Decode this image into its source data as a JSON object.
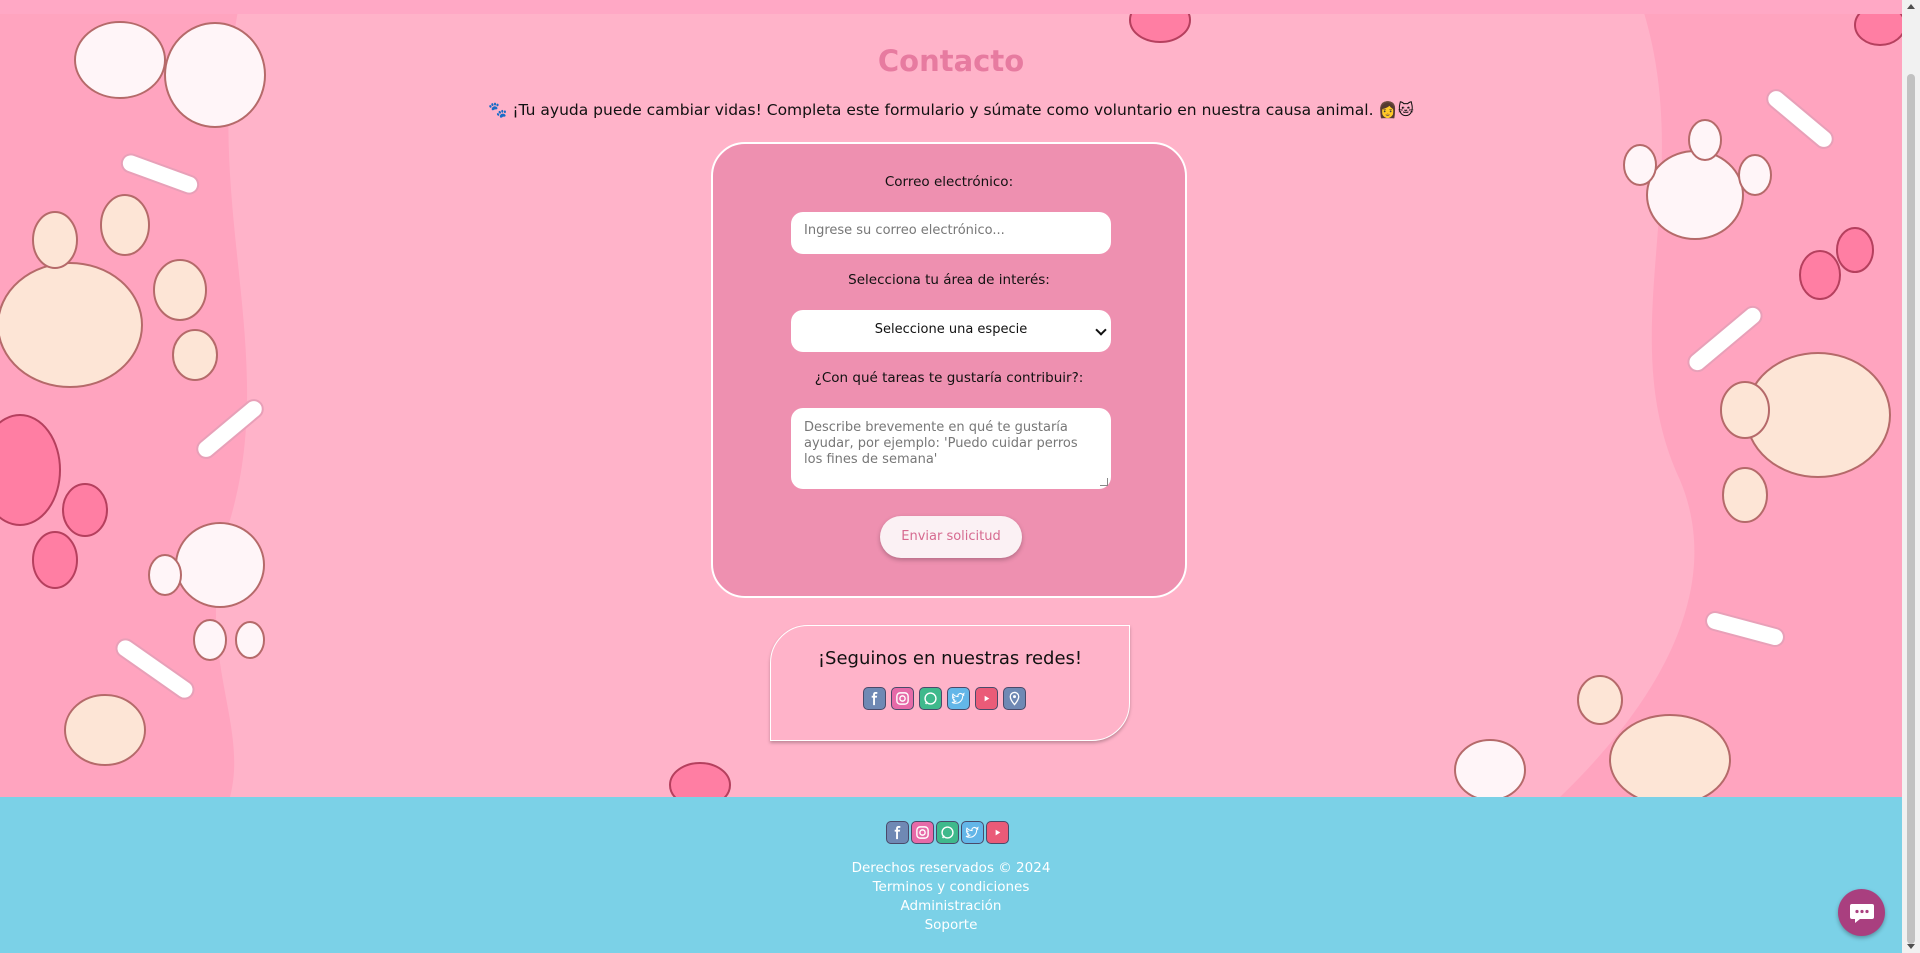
{
  "page": {
    "title": "Contacto",
    "intro": "🐾 ¡Tu ayuda puede cambiar vidas! Completa este formulario y súmate como voluntario en nuestra causa animal. 👩🐱"
  },
  "form": {
    "email_label": "Correo electrónico:",
    "email_placeholder": "Ingrese su correo electrónico...",
    "interest_label": "Selecciona tu área de interés:",
    "interest_selected": "Seleccione una especie",
    "tasks_label": "¿Con qué tareas te gustaría contribuir?:",
    "tasks_placeholder": "Describe brevemente en qué te gustaría ayudar, por ejemplo: 'Puedo cuidar perros los fines de semana'",
    "submit_label": "Enviar solicitud"
  },
  "social": {
    "title": "¡Seguinos en nuestras redes!",
    "icons": [
      "facebook-icon",
      "instagram-icon",
      "whatsapp-icon",
      "twitter-icon",
      "youtube-icon",
      "location-icon"
    ]
  },
  "footer": {
    "icons": [
      "facebook-icon",
      "instagram-icon",
      "whatsapp-icon",
      "twitter-icon",
      "youtube-icon"
    ],
    "copyright": "Derechos reservados © 2024",
    "terms": "Terminos y condiciones",
    "admin": "Administración",
    "support": "Soporte"
  },
  "colors": {
    "background": "#ffb3c9",
    "form_card": "#ee90b0",
    "footer": "#7bd1e7",
    "title": "#e77ba0",
    "chat_button": "#a93f7f"
  }
}
